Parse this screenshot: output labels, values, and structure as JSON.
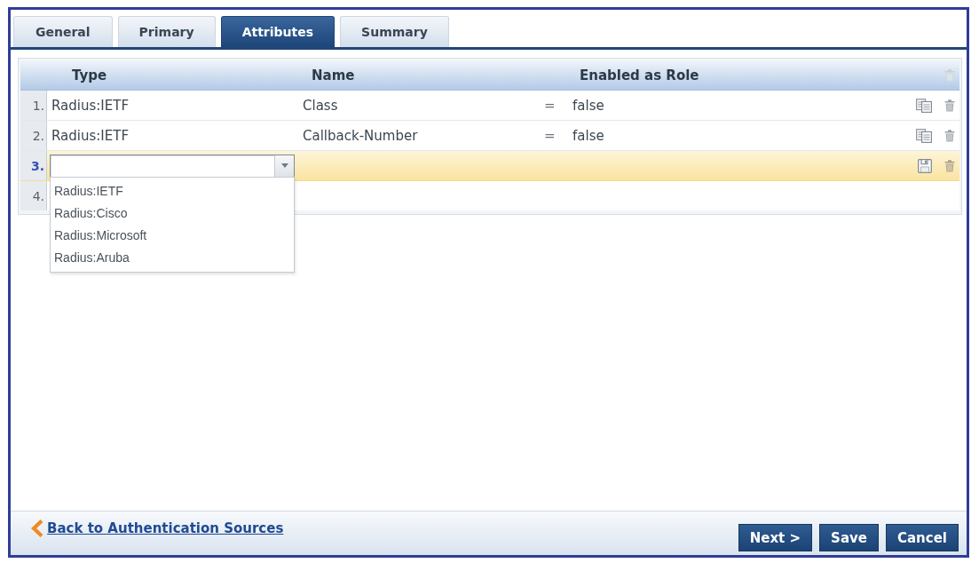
{
  "tabs": [
    {
      "label": "General",
      "selected": false
    },
    {
      "label": "Primary",
      "selected": false
    },
    {
      "label": "Attributes",
      "selected": true
    },
    {
      "label": "Summary",
      "selected": false
    }
  ],
  "attributes_table": {
    "columns": [
      "Type",
      "Name",
      "Enabled as Role"
    ],
    "rows": [
      {
        "kind": "saved",
        "number": "1.",
        "type": "Radius:IETF",
        "name": "Class",
        "operator": "=",
        "value": "false"
      },
      {
        "kind": "saved",
        "number": "2.",
        "type": "Radius:IETF",
        "name": "Callback-Number",
        "operator": "=",
        "value": "false"
      },
      {
        "kind": "editing",
        "number": "3.",
        "type_options": [
          "Radius:IETF",
          "Radius:Cisco",
          "Radius:Microsoft",
          "Radius:Aruba"
        ]
      },
      {
        "kind": "empty",
        "number": "4."
      }
    ]
  },
  "back_link": "Back to Authentication Sources",
  "buttons": [
    "Next >",
    "Save",
    "Cancel"
  ]
}
